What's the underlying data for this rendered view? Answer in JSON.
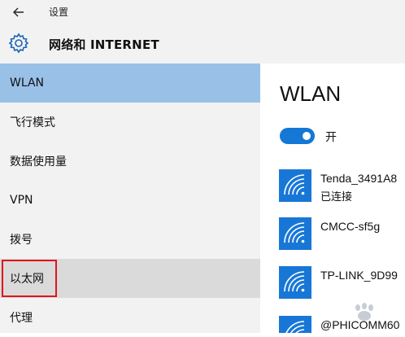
{
  "titlebar": {
    "title": "设置"
  },
  "header": {
    "section_title": "网络和 INTERNET"
  },
  "sidebar": {
    "items": [
      {
        "label": "WLAN"
      },
      {
        "label": "飞行模式"
      },
      {
        "label": "数据使用量"
      },
      {
        "label": "VPN"
      },
      {
        "label": "拨号"
      },
      {
        "label": "以太网"
      },
      {
        "label": "代理"
      }
    ],
    "selected_index": 0,
    "hover_index": 5
  },
  "main": {
    "title": "WLAN",
    "toggle_label": "开",
    "toggle_on": true,
    "networks": [
      {
        "name": "Tenda_3491A8",
        "status": "已连接"
      },
      {
        "name": "CMCC-sf5g",
        "status": ""
      },
      {
        "name": "TP-LINK_9D99",
        "status": ""
      },
      {
        "name": "@PHICOMM60",
        "status": ""
      }
    ]
  },
  "colors": {
    "selected": "#99c1e8",
    "accent": "#1877d6",
    "highlight_border": "#e0151c",
    "chrome_bg": "#f2f2f2"
  },
  "icons": [
    "back-arrow-icon",
    "gear-icon",
    "wifi-signal-icon"
  ]
}
